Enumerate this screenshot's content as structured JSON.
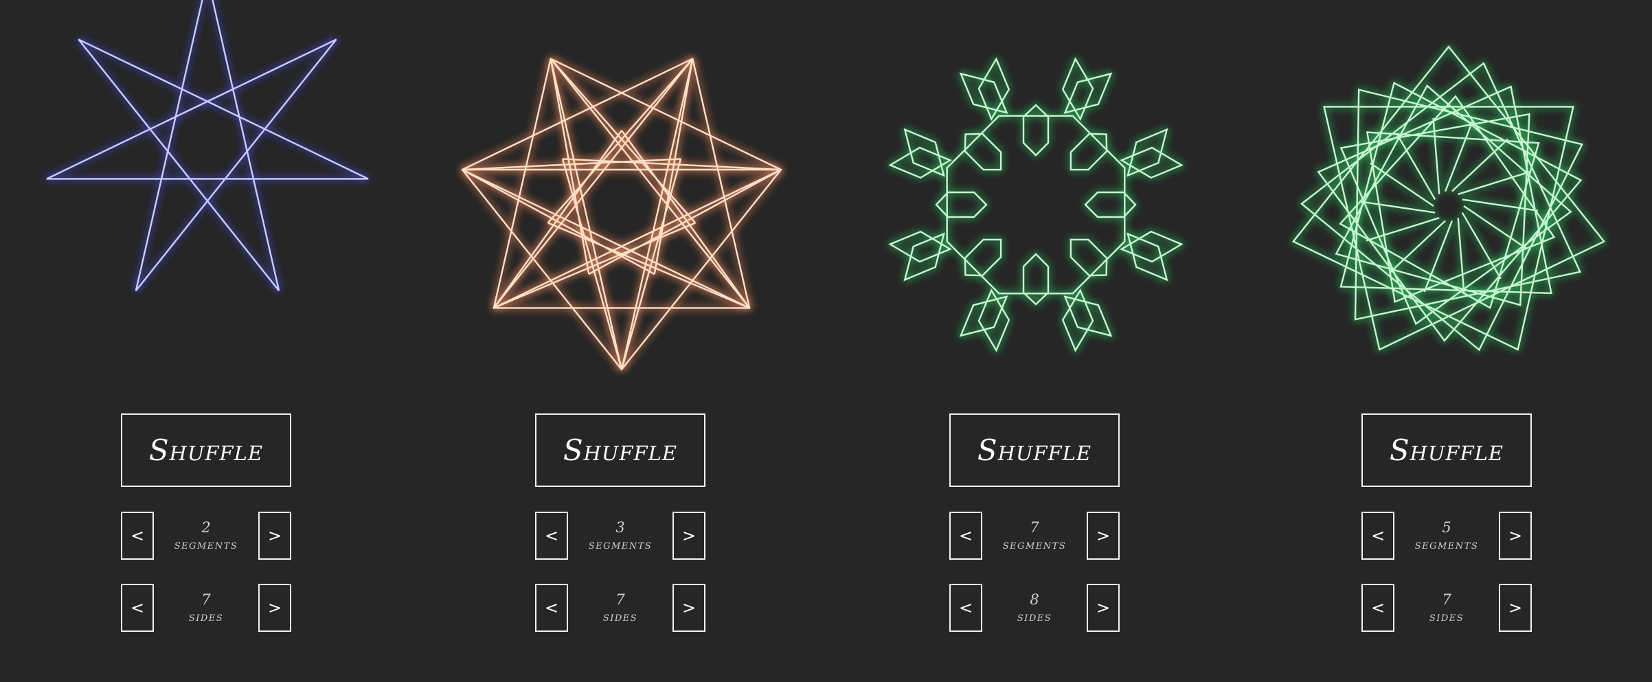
{
  "panels": [
    {
      "shuffle_label": "Shuffle",
      "segments": {
        "value": "2",
        "label": "segments",
        "prev": "<",
        "next": ">"
      },
      "sides": {
        "value": "7",
        "label": "sides",
        "prev": "<",
        "next": ">"
      },
      "color": "#c9ccff",
      "glow": "#4b4fd8",
      "icon": "heptagram-star-icon"
    },
    {
      "shuffle_label": "Shuffle",
      "segments": {
        "value": "3",
        "label": "segments",
        "prev": "<",
        "next": ">"
      },
      "sides": {
        "value": "7",
        "label": "sides",
        "prev": "<",
        "next": ">"
      },
      "color": "#ffe0c8",
      "glow": "#e8865a",
      "icon": "faceted-star-icon"
    },
    {
      "shuffle_label": "Shuffle",
      "segments": {
        "value": "7",
        "label": "segments",
        "prev": "<",
        "next": ">"
      },
      "sides": {
        "value": "8",
        "label": "sides",
        "prev": "<",
        "next": ">"
      },
      "color": "#c8f5d2",
      "glow": "#2fbf5c",
      "icon": "octagonal-rosette-icon"
    },
    {
      "shuffle_label": "Shuffle",
      "segments": {
        "value": "5",
        "label": "segments",
        "prev": "<",
        "next": ">"
      },
      "sides": {
        "value": "7",
        "label": "sides",
        "prev": "<",
        "next": ">"
      },
      "color": "#c8f5d2",
      "glow": "#2fbf5c",
      "icon": "layered-polygon-mandala-icon"
    }
  ]
}
